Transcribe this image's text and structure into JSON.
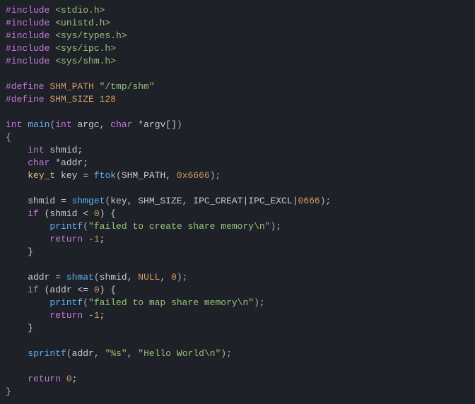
{
  "code": {
    "lines": [
      {
        "t": [
          {
            "c": "tok-preproc",
            "v": "#include "
          },
          {
            "c": "tok-include",
            "v": "<stdio.h>"
          }
        ]
      },
      {
        "t": [
          {
            "c": "tok-preproc",
            "v": "#include "
          },
          {
            "c": "tok-include",
            "v": "<unistd.h>"
          }
        ]
      },
      {
        "t": [
          {
            "c": "tok-preproc",
            "v": "#include "
          },
          {
            "c": "tok-include",
            "v": "<sys/types.h>"
          }
        ]
      },
      {
        "t": [
          {
            "c": "tok-preproc",
            "v": "#include "
          },
          {
            "c": "tok-include",
            "v": "<sys/ipc.h>"
          }
        ]
      },
      {
        "t": [
          {
            "c": "tok-preproc",
            "v": "#include "
          },
          {
            "c": "tok-include",
            "v": "<sys/shm.h>"
          }
        ]
      },
      {
        "t": [
          {
            "c": "tok-plain",
            "v": ""
          }
        ]
      },
      {
        "t": [
          {
            "c": "tok-preproc",
            "v": "#define "
          },
          {
            "c": "tok-macro",
            "v": "SHM_PATH "
          },
          {
            "c": "tok-string",
            "v": "\"/tmp/shm\""
          }
        ]
      },
      {
        "t": [
          {
            "c": "tok-preproc",
            "v": "#define "
          },
          {
            "c": "tok-macro",
            "v": "SHM_SIZE "
          },
          {
            "c": "tok-number",
            "v": "128"
          }
        ]
      },
      {
        "t": [
          {
            "c": "tok-plain",
            "v": ""
          }
        ]
      },
      {
        "t": [
          {
            "c": "tok-type",
            "v": "int"
          },
          {
            "c": "tok-plain",
            "v": " "
          },
          {
            "c": "tok-func",
            "v": "main"
          },
          {
            "c": "tok-punct",
            "v": "("
          },
          {
            "c": "tok-type",
            "v": "int"
          },
          {
            "c": "tok-plain",
            "v": " argc, "
          },
          {
            "c": "tok-type",
            "v": "char"
          },
          {
            "c": "tok-plain",
            "v": " *argv[]"
          },
          {
            "c": "tok-punct",
            "v": ")"
          }
        ]
      },
      {
        "t": [
          {
            "c": "tok-punct",
            "v": "{"
          }
        ]
      },
      {
        "t": [
          {
            "c": "tok-plain",
            "v": "    "
          },
          {
            "c": "tok-type",
            "v": "int"
          },
          {
            "c": "tok-plain",
            "v": " shmid;"
          }
        ]
      },
      {
        "t": [
          {
            "c": "tok-plain",
            "v": "    "
          },
          {
            "c": "tok-type",
            "v": "char"
          },
          {
            "c": "tok-plain",
            "v": " *addr;"
          }
        ]
      },
      {
        "t": [
          {
            "c": "tok-plain",
            "v": "    "
          },
          {
            "c": "tok-typealt",
            "v": "key_t"
          },
          {
            "c": "tok-plain",
            "v": " key = "
          },
          {
            "c": "tok-func",
            "v": "ftok"
          },
          {
            "c": "tok-punct",
            "v": "("
          },
          {
            "c": "tok-plain",
            "v": "SHM_PATH, "
          },
          {
            "c": "tok-number",
            "v": "0x6666"
          },
          {
            "c": "tok-punct",
            "v": ");"
          }
        ]
      },
      {
        "t": [
          {
            "c": "tok-plain",
            "v": ""
          }
        ]
      },
      {
        "t": [
          {
            "c": "tok-plain",
            "v": "    shmid = "
          },
          {
            "c": "tok-func",
            "v": "shmget"
          },
          {
            "c": "tok-punct",
            "v": "("
          },
          {
            "c": "tok-plain",
            "v": "key, SHM_SIZE, IPC_CREAT|IPC_EXCL|"
          },
          {
            "c": "tok-number",
            "v": "0666"
          },
          {
            "c": "tok-punct",
            "v": ");"
          }
        ]
      },
      {
        "t": [
          {
            "c": "tok-plain",
            "v": "    "
          },
          {
            "c": "tok-keyword",
            "v": "if"
          },
          {
            "c": "tok-plain",
            "v": " (shmid < "
          },
          {
            "c": "tok-number",
            "v": "0"
          },
          {
            "c": "tok-plain",
            "v": ") {"
          }
        ]
      },
      {
        "t": [
          {
            "c": "tok-plain",
            "v": "        "
          },
          {
            "c": "tok-func",
            "v": "printf"
          },
          {
            "c": "tok-punct",
            "v": "("
          },
          {
            "c": "tok-string",
            "v": "\"failed to create share memory\\n\""
          },
          {
            "c": "tok-punct",
            "v": ");"
          }
        ]
      },
      {
        "t": [
          {
            "c": "tok-plain",
            "v": "        "
          },
          {
            "c": "tok-keyword",
            "v": "return"
          },
          {
            "c": "tok-plain",
            "v": " -"
          },
          {
            "c": "tok-number",
            "v": "1"
          },
          {
            "c": "tok-plain",
            "v": ";"
          }
        ]
      },
      {
        "t": [
          {
            "c": "tok-plain",
            "v": "    }"
          }
        ]
      },
      {
        "t": [
          {
            "c": "tok-plain",
            "v": ""
          }
        ]
      },
      {
        "t": [
          {
            "c": "tok-plain",
            "v": "    addr = "
          },
          {
            "c": "tok-func",
            "v": "shmat"
          },
          {
            "c": "tok-punct",
            "v": "("
          },
          {
            "c": "tok-plain",
            "v": "shmid, "
          },
          {
            "c": "tok-number",
            "v": "NULL"
          },
          {
            "c": "tok-plain",
            "v": ", "
          },
          {
            "c": "tok-number",
            "v": "0"
          },
          {
            "c": "tok-punct",
            "v": ");"
          }
        ]
      },
      {
        "t": [
          {
            "c": "tok-plain",
            "v": "    "
          },
          {
            "c": "tok-keyword",
            "v": "if"
          },
          {
            "c": "tok-plain",
            "v": " (addr <= "
          },
          {
            "c": "tok-number",
            "v": "0"
          },
          {
            "c": "tok-plain",
            "v": ") {"
          }
        ]
      },
      {
        "t": [
          {
            "c": "tok-plain",
            "v": "        "
          },
          {
            "c": "tok-func",
            "v": "printf"
          },
          {
            "c": "tok-punct",
            "v": "("
          },
          {
            "c": "tok-string",
            "v": "\"failed to map share memory\\n\""
          },
          {
            "c": "tok-punct",
            "v": ");"
          }
        ]
      },
      {
        "t": [
          {
            "c": "tok-plain",
            "v": "        "
          },
          {
            "c": "tok-keyword",
            "v": "return"
          },
          {
            "c": "tok-plain",
            "v": " -"
          },
          {
            "c": "tok-number",
            "v": "1"
          },
          {
            "c": "tok-plain",
            "v": ";"
          }
        ]
      },
      {
        "t": [
          {
            "c": "tok-plain",
            "v": "    }"
          }
        ]
      },
      {
        "t": [
          {
            "c": "tok-plain",
            "v": ""
          }
        ]
      },
      {
        "t": [
          {
            "c": "tok-plain",
            "v": "    "
          },
          {
            "c": "tok-func",
            "v": "sprintf"
          },
          {
            "c": "tok-punct",
            "v": "("
          },
          {
            "c": "tok-plain",
            "v": "addr, "
          },
          {
            "c": "tok-string",
            "v": "\"%s\""
          },
          {
            "c": "tok-plain",
            "v": ", "
          },
          {
            "c": "tok-string",
            "v": "\"Hello World\\n\""
          },
          {
            "c": "tok-punct",
            "v": ");"
          }
        ]
      },
      {
        "t": [
          {
            "c": "tok-plain",
            "v": ""
          }
        ]
      },
      {
        "t": [
          {
            "c": "tok-plain",
            "v": "    "
          },
          {
            "c": "tok-keyword",
            "v": "return"
          },
          {
            "c": "tok-plain",
            "v": " "
          },
          {
            "c": "tok-number",
            "v": "0"
          },
          {
            "c": "tok-plain",
            "v": ";"
          }
        ]
      },
      {
        "t": [
          {
            "c": "tok-punct",
            "v": "}"
          }
        ]
      }
    ]
  }
}
